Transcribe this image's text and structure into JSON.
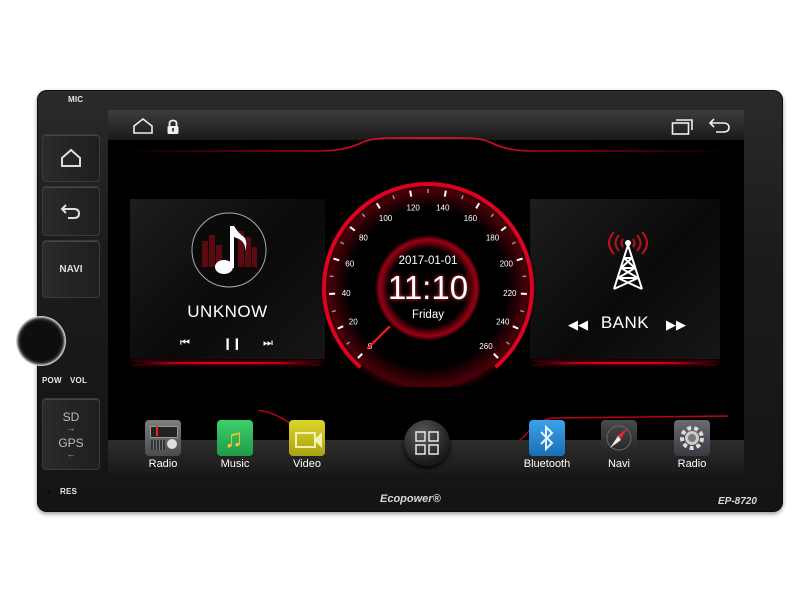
{
  "device": {
    "brand": "Ecopower®",
    "model": "EP-8720",
    "labels": {
      "mic": "MIC",
      "navi": "NAVI",
      "pow": "POW",
      "vol": "VOL",
      "sd": "SD",
      "gps": "GPS",
      "res": "RES"
    },
    "hardware_buttons": [
      {
        "name": "home",
        "icon": "home-icon"
      },
      {
        "name": "back",
        "icon": "back-arrow-icon"
      },
      {
        "name": "navi",
        "label": "NAVI"
      }
    ]
  },
  "statusbar": {
    "left_icons": [
      "home-icon",
      "lock-icon"
    ],
    "right_icons": [
      "recent-apps-icon",
      "back-icon"
    ]
  },
  "music_widget": {
    "title": "UNKNOW",
    "icon": "music-note-icon",
    "controls": [
      "previous",
      "pause",
      "next"
    ]
  },
  "clock_widget": {
    "date": "2017-01-01",
    "time": "11:10",
    "day": "Friday",
    "speedometer": {
      "ticks": [
        "0",
        "20",
        "40",
        "60",
        "80",
        "100",
        "120",
        "140",
        "160",
        "180",
        "200",
        "220",
        "240",
        "260"
      ],
      "min": 0,
      "max": 260,
      "needle_value": 0
    }
  },
  "radio_widget": {
    "label": "BANK",
    "icon": "radio-tower-icon",
    "controls": [
      "seek-back",
      "seek-forward"
    ]
  },
  "dock": {
    "apps": [
      {
        "label": "Radio",
        "icon": "radio-icon"
      },
      {
        "label": "Music",
        "icon": "music-icon"
      },
      {
        "label": "Video",
        "icon": "video-icon"
      },
      {
        "label": "Bluetooth",
        "icon": "bluetooth-icon"
      },
      {
        "label": "Navi",
        "icon": "compass-icon"
      },
      {
        "label": "Radio",
        "icon": "settings-gear-icon"
      }
    ],
    "app_drawer_icon": "app-grid-icon"
  },
  "colors": {
    "accent_red": "#e0001f",
    "bluetooth_blue": "#2a8fd8",
    "music_green": "#2fb35b",
    "video_yellow": "#c9c21a"
  }
}
